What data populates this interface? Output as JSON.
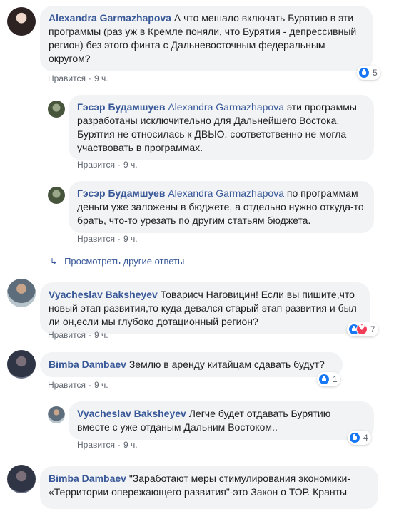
{
  "comments": [
    {
      "author": "Alexandra Garmazhapova",
      "text": "А что мешало включать Бурятию в эти программы (раз уж в Кремле поняли, что Бурятия - депрессивный регион) без этого финта с Дальневосточным федеральным округом?",
      "like_label": "Нравится",
      "time": "9 ч.",
      "reaction_count": "5",
      "replies": [
        {
          "author": "Гэсэр Будамшуев",
          "mention": "Alexandra Garmazhapova",
          "text": "эти программы разработаны исключительно для Дальнейшего Востока. Бурятия не относилась к ДВЫО, соответственно не могла участвовать в программах.",
          "like_label": "Нравится",
          "time": "9 ч."
        },
        {
          "author": "Гэсэр Будамшуев",
          "mention": "Alexandra Garmazhapova",
          "text": "по программам деньги уже заложены в бюджете, а отдельно нужно откуда-то брать, что-то урезать по другим статьям бюджета.",
          "like_label": "Нравится",
          "time": "9 ч."
        }
      ],
      "more_replies_label": "Просмотреть другие ответы"
    },
    {
      "author": "Vyacheslav Baksheyev",
      "text": "Товарисч Наговицин! Если вы пишите,что новый этап развития,то куда девался старый этап развития и был ли он,если мы глубоко дотационный регион?",
      "like_label": "Нравится",
      "time": "9 ч.",
      "reaction_count": "7"
    },
    {
      "author": "Bimba Dambaev",
      "text": "Землю в аренду китайцам сдавать будут?",
      "like_label": "Нравится",
      "time": "9 ч.",
      "reaction_count": "1",
      "replies": [
        {
          "author": "Vyacheslav Baksheyev",
          "text": "Легче будет отдавать Бурятию вместе с уже отданым Дальним Востоком..",
          "like_label": "Нравится",
          "time": "9 ч.",
          "reaction_count": "4"
        }
      ]
    },
    {
      "author": "Bimba Dambaev",
      "text": "\"Заработают меры стимулирования экономики- «Территории опережающего развития\"-это Закон о ТОР. Кранты"
    }
  ],
  "colors": {
    "name": "#385898",
    "bubble": "#f2f3f5",
    "like": "#1877f2",
    "love": "#f33e58"
  },
  "icons": {
    "like": "like-reaction-icon",
    "love": "love-reaction-icon",
    "reply_arrow": "reply-arrow-icon"
  }
}
